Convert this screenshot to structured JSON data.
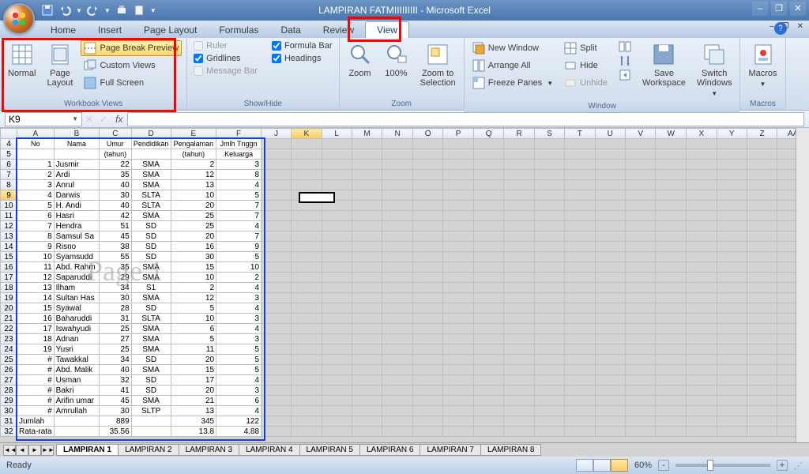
{
  "app": {
    "title": "LAMPIRAN FATMIIIIIIIII - Microsoft Excel"
  },
  "qat_icons": [
    "save",
    "undo",
    "redo",
    "print",
    "new"
  ],
  "tabs": {
    "items": [
      "Home",
      "Insert",
      "Page Layout",
      "Formulas",
      "Data",
      "Review",
      "View"
    ],
    "active": 6
  },
  "ribbon": {
    "workbook_views": {
      "label": "Workbook Views",
      "normal": "Normal",
      "page_layout": "Page\nLayout",
      "page_break": "Page Break Preview",
      "custom": "Custom Views",
      "full": "Full Screen"
    },
    "show_hide": {
      "label": "Show/Hide",
      "ruler": "Ruler",
      "gridlines": "Gridlines",
      "msgbar": "Message Bar",
      "formula": "Formula Bar",
      "headings": "Headings"
    },
    "zoom": {
      "label": "Zoom",
      "zoom": "Zoom",
      "hundred": "100%",
      "sel": "Zoom to\nSelection"
    },
    "window": {
      "label": "Window",
      "new": "New Window",
      "arrange": "Arrange All",
      "freeze": "Freeze Panes",
      "split": "Split",
      "hide": "Hide",
      "unhide": "Unhide",
      "save_ws": "Save\nWorkspace",
      "switch": "Switch\nWindows"
    },
    "macros": {
      "label": "Macros",
      "btn": "Macros"
    }
  },
  "namebox": "K9",
  "columns": [
    "A",
    "B",
    "C",
    "D",
    "E",
    "F",
    "J",
    "K",
    "L",
    "M",
    "N",
    "O",
    "P",
    "Q",
    "R",
    "S",
    "T",
    "U",
    "V",
    "W",
    "X",
    "Y",
    "Z",
    "AA"
  ],
  "headers": {
    "r4": [
      "No",
      "Nama",
      "Umur",
      "Pendidikan",
      "Pengalaman",
      "Jmlh Tnggn"
    ],
    "r5": [
      "",
      "",
      "(tahun)",
      "",
      "(tahun)",
      "Keluarga"
    ]
  },
  "rows": [
    {
      "rn": 6,
      "d": [
        "1",
        "Jusmir",
        "22",
        "SMA",
        "2",
        "3"
      ]
    },
    {
      "rn": 7,
      "d": [
        "2",
        "Ardi",
        "35",
        "SMA",
        "12",
        "8"
      ]
    },
    {
      "rn": 8,
      "d": [
        "3",
        "Anrul",
        "40",
        "SMA",
        "13",
        "4"
      ]
    },
    {
      "rn": 9,
      "d": [
        "4",
        "Darwis",
        "30",
        "SLTA",
        "10",
        "5"
      ]
    },
    {
      "rn": 10,
      "d": [
        "5",
        "H. Andi",
        "40",
        "SLTA",
        "20",
        "7"
      ]
    },
    {
      "rn": 11,
      "d": [
        "6",
        "Hasri",
        "42",
        "SMA",
        "25",
        "7"
      ]
    },
    {
      "rn": 12,
      "d": [
        "7",
        "Hendra",
        "51",
        "SD",
        "25",
        "4"
      ]
    },
    {
      "rn": 13,
      "d": [
        "8",
        "Samsul Sa",
        "45",
        "SD",
        "20",
        "7"
      ]
    },
    {
      "rn": 14,
      "d": [
        "9",
        "Risno",
        "38",
        "SD",
        "16",
        "9"
      ]
    },
    {
      "rn": 15,
      "d": [
        "10",
        "Syamsudd",
        "55",
        "SD",
        "30",
        "5"
      ]
    },
    {
      "rn": 16,
      "d": [
        "11",
        "Abd. Rahm",
        "35",
        "SMA",
        "15",
        "10"
      ]
    },
    {
      "rn": 17,
      "d": [
        "12",
        "Saparuddi",
        "29",
        "SMA",
        "10",
        "2"
      ]
    },
    {
      "rn": 18,
      "d": [
        "13",
        "Ilham",
        "34",
        "S1",
        "2",
        "4"
      ]
    },
    {
      "rn": 19,
      "d": [
        "14",
        "Sultan Has",
        "30",
        "SMA",
        "12",
        "3"
      ]
    },
    {
      "rn": 20,
      "d": [
        "15",
        "Syawal",
        "28",
        "SD",
        "5",
        "4"
      ]
    },
    {
      "rn": 21,
      "d": [
        "16",
        "Baharuddi",
        "31",
        "SLTA",
        "10",
        "3"
      ]
    },
    {
      "rn": 22,
      "d": [
        "17",
        "Iswahyudi",
        "25",
        "SMA",
        "6",
        "4"
      ]
    },
    {
      "rn": 23,
      "d": [
        "18",
        "Adnan",
        "27",
        "SMA",
        "5",
        "3"
      ]
    },
    {
      "rn": 24,
      "d": [
        "19",
        "Yusri",
        "25",
        "SMA",
        "11",
        "5"
      ]
    },
    {
      "rn": 25,
      "d": [
        "#",
        "Tawakkal",
        "34",
        "SD",
        "20",
        "5"
      ]
    },
    {
      "rn": 26,
      "d": [
        "#",
        "Abd. Malik",
        "40",
        "SMA",
        "15",
        "5"
      ]
    },
    {
      "rn": 27,
      "d": [
        "#",
        "Usman",
        "32",
        "SD",
        "17",
        "4"
      ]
    },
    {
      "rn": 28,
      "d": [
        "#",
        "Bakri",
        "41",
        "SD",
        "20",
        "3"
      ]
    },
    {
      "rn": 29,
      "d": [
        "#",
        "Arifin umar",
        "45",
        "SMA",
        "21",
        "6"
      ]
    },
    {
      "rn": 30,
      "d": [
        "#",
        "Amrullah",
        "30",
        "SLTP",
        "13",
        "4"
      ]
    }
  ],
  "totals": [
    {
      "rn": 31,
      "d": [
        "Jumlah",
        "",
        "889",
        "",
        "345",
        "122"
      ]
    },
    {
      "rn": 32,
      "d": [
        "Rata-rata",
        "",
        "35.56",
        "",
        "13.8",
        "4.88"
      ]
    }
  ],
  "page_watermark": "Page 1",
  "sheets": [
    "LAMPIRAN 1",
    "LAMPIRAN 2",
    "LAMPIRAN 3",
    "LAMPIRAN 4",
    "LAMPIRAN 5",
    "LAMPIRAN 6",
    "LAMPIRAN 7",
    "LAMPIRAN 8"
  ],
  "active_sheet": 0,
  "status": {
    "left": "Ready",
    "zoom": "60%",
    "zoom_out": "-",
    "zoom_in": "+"
  }
}
